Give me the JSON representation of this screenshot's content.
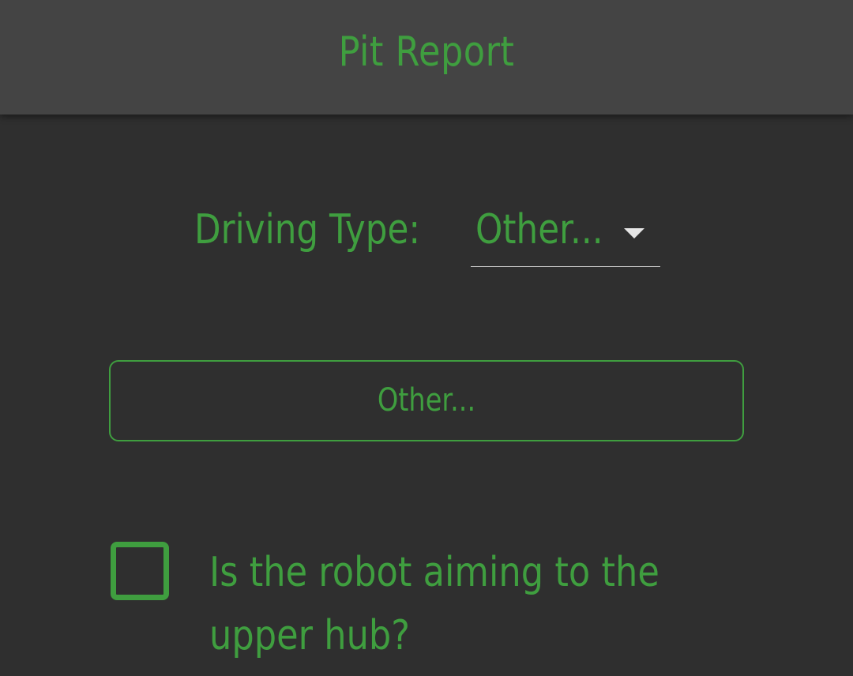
{
  "header": {
    "title": "Pit Report"
  },
  "form": {
    "driving_type_label": "Driving Type:",
    "driving_type_value": "Other...",
    "other_button_label": "Other...",
    "upper_hub_question": "Is the robot aiming to the upper hub?",
    "upper_hub_checked": false
  },
  "colors": {
    "accent": "#3f9e3f",
    "app_bar": "#444444",
    "background": "#2f2f2f",
    "caret": "#e6e6e6",
    "underline": "#bdbdbd"
  },
  "icons": {
    "dropdown": "triangle-down-icon"
  }
}
